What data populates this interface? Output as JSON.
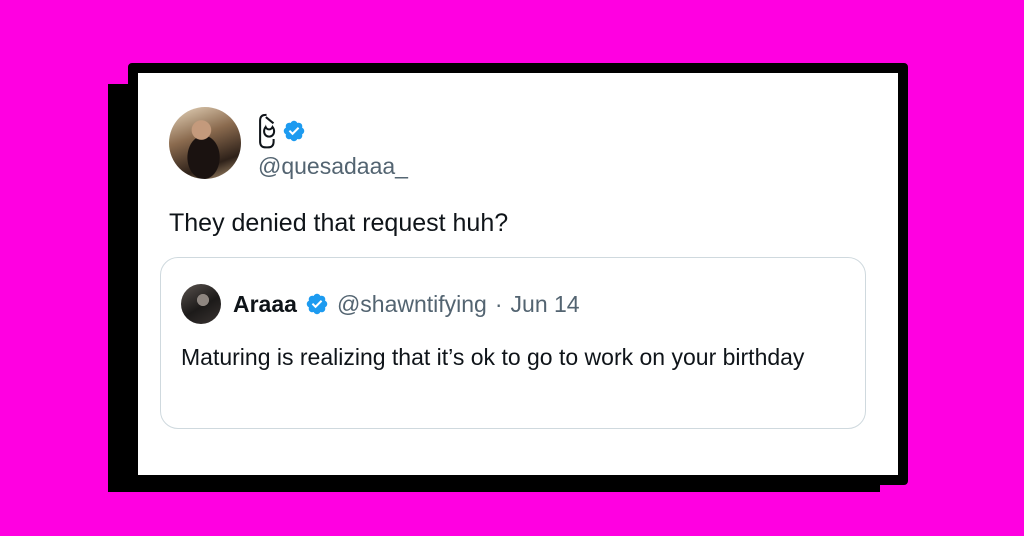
{
  "tweet": {
    "display_name": "ဗြဲ",
    "handle": "@quesadaaa_",
    "text": "They denied that request huh?",
    "verified": true
  },
  "quoted_tweet": {
    "display_name": "Araaa",
    "handle": "@shawntifying",
    "separator": "·",
    "date": "Jun 14",
    "text": "Maturing is realizing that it’s ok to go to work on your birthday",
    "verified": true
  },
  "colors": {
    "background": "#ff00e1",
    "verified_badge": "#1d9bf0",
    "text_primary": "#0f1419",
    "text_secondary": "#536471",
    "quote_border": "#cfd9de"
  },
  "icons": {
    "verified": "verified-badge-icon"
  }
}
